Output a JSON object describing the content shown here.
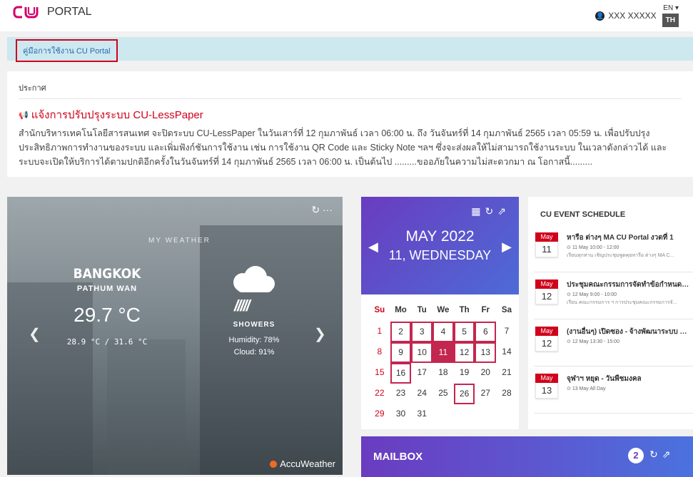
{
  "header": {
    "logo": "CU",
    "title": "PORTAL",
    "user": "XXX XXXXX",
    "lang_en": "EN",
    "lang_th": "TH"
  },
  "manual": {
    "link": "คู่มือการใช้งาน CU Portal"
  },
  "announcement": {
    "heading": "ประกาศ",
    "title": "แจ้งการปรับปรุงระบบ CU-LessPaper",
    "body": "สำนักบริหารเทคโนโลยีสารสนเทศ จะปิดระบบ CU-LessPaper ในวันเสาร์ที่ 12 กุมภาพันธ์ เวลา 06:00 น. ถึง วันจันทร์ที่ 14 กุมภาพันธ์ 2565 เวลา 05:59 น. เพื่อปรับปรุงประสิทธิภาพการทำงานของระบบ และเพิ่มฟังก์ชันการใช้งาน เช่น การใช้งาน QR Code และ Sticky Note ฯลฯ ซึ่งจะส่งผลให้ไม่สามารถใช้งานระบบ ในเวลาดังกล่าวได้ และระบบจะเปิดให้บริการได้ตามปกติอีกครั้งในวันจันทร์ที่ 14 กุมภาพันธ์ 2565 เวลา 06:00 น. เป็นต้นไป .........ขออภัยในความไม่สะดวกมา ณ โอกาสนี้........."
  },
  "weather": {
    "title": "MY WEATHER",
    "city": "BANGKOK",
    "area": "PATHUM WAN",
    "temp": "29.7 °C",
    "range": "28.9 °C / 31.6 °C",
    "condition": "SHOWERS",
    "humidity": "Humidity: 78%",
    "cloud": "Cloud: 91%",
    "brand": "AccuWeather"
  },
  "calendar": {
    "month": "MAY 2022",
    "day": "11, WEDNESDAY",
    "weekdays": [
      "Su",
      "Mo",
      "Tu",
      "We",
      "Th",
      "Fr",
      "Sa"
    ],
    "weeks": [
      [
        "1",
        "2",
        "3",
        "4",
        "5",
        "6",
        "7"
      ],
      [
        "8",
        "9",
        "10",
        "11",
        "12",
        "13",
        "14"
      ],
      [
        "15",
        "16",
        "17",
        "18",
        "19",
        "20",
        "21"
      ],
      [
        "22",
        "23",
        "24",
        "25",
        "26",
        "27",
        "28"
      ],
      [
        "29",
        "30",
        "31",
        "",
        "",
        "",
        ""
      ]
    ],
    "event_days": [
      "2",
      "3",
      "4",
      "5",
      "6",
      "9",
      "10",
      "12",
      "13",
      "16",
      "26"
    ],
    "today": "11"
  },
  "events": {
    "title": "CU EVENT SCHEDULE",
    "items": [
      {
        "month": "May",
        "day": "11",
        "name": "หารือ ต่างๆ MA CU Portal งวดที่ 1",
        "time": "11 May 10:00 - 12:00",
        "desc": "เรียนทุกท่าน เชิญประชุมพูดคุยหารือ ต่างๆ MA C..."
      },
      {
        "month": "May",
        "day": "12",
        "name": "ประชุมคณะกรรมการจัดทำข้อกำหนดและ...",
        "time": "12 May 9:00 - 10:00",
        "desc": "เรียน คณะกรรมการ ฯ การประชุมคณะกรรมการจั..."
      },
      {
        "month": "May",
        "day": "12",
        "name": "(งานอื่นๆ) เปิดซอง - จ้างพัฒนาระบบ M...",
        "time": "12 May 13:30 - 15:00",
        "desc": ""
      },
      {
        "month": "May",
        "day": "13",
        "name": "จุฬาฯ หยุด - วันพืชมงคล",
        "time": "13 May All Day",
        "desc": ""
      }
    ]
  },
  "mailbox": {
    "title": "MAILBOX",
    "count": "2"
  }
}
